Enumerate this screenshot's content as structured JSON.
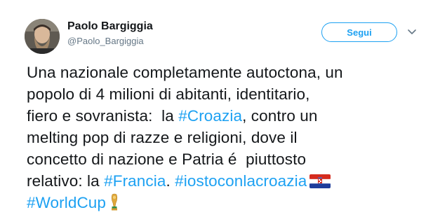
{
  "user": {
    "display_name": "Paolo Bargiggia",
    "handle": "@Paolo_Bargiggia"
  },
  "follow_button": {
    "label": "Segui"
  },
  "tweet": {
    "l1": "Una nazionale completamente autoctona, un",
    "l2": "popolo di 4 milioni di abitanti, identitario,",
    "l3_pre": "fiero e sovranista:  la ",
    "l3_tag": "#Croazia",
    "l3_post": ", contro un",
    "l4": "melting pop di razze e religioni, dove il",
    "l5": "concetto di nazione e Patria é  piuttosto",
    "l6_pre": "relativo: la ",
    "l6_tag1": "#Francia",
    "l6_mid": ". ",
    "l6_tag2": "#iostoconlacroazia",
    "l7_tag": "#WorldCup"
  },
  "icons": {
    "caret": "chevron-down-icon",
    "flag": "croatia-flag-emoji",
    "trophy": "trophy-emoji"
  },
  "colors": {
    "link": "#1da1f2",
    "text": "#14171a",
    "secondary": "#657786"
  }
}
